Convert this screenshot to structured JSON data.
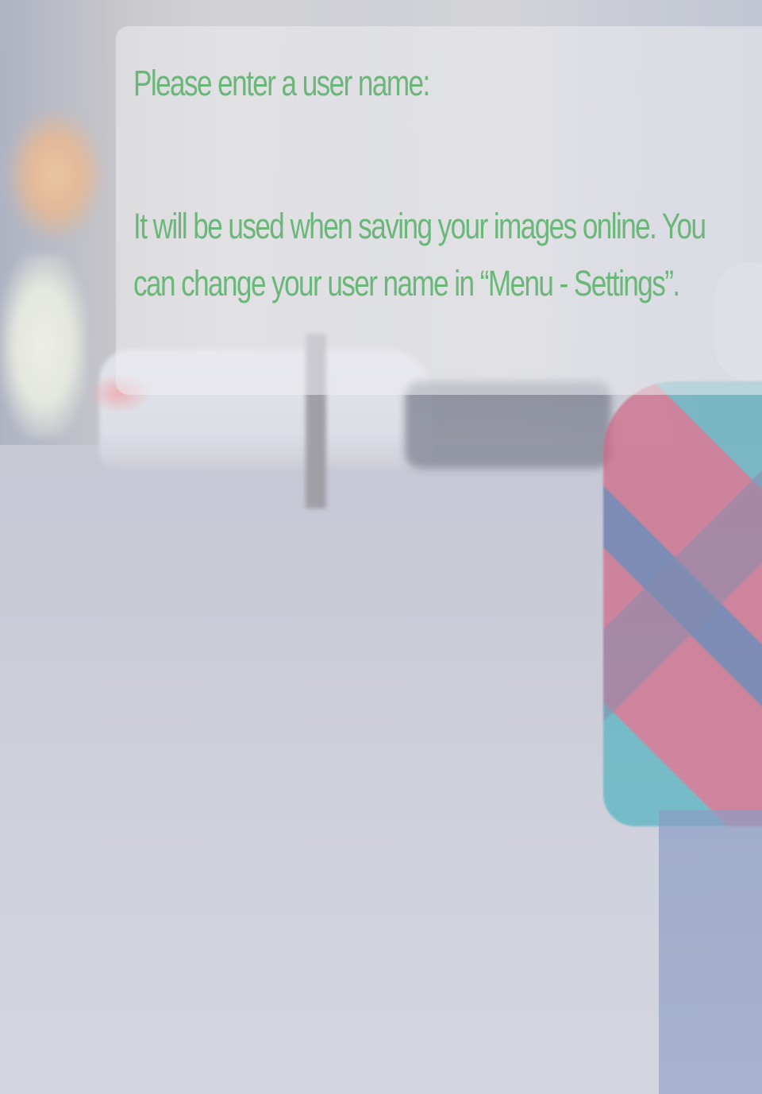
{
  "dialog": {
    "title": "Please enter a user name:",
    "body": "It will be used when saving your images online. You can change your user name in “Menu - Settings”."
  },
  "colors": {
    "text": "#6bb77a",
    "panel": "rgba(236,236,240,0.55)"
  },
  "background": {
    "description_icon": "blurred-street-photo"
  }
}
